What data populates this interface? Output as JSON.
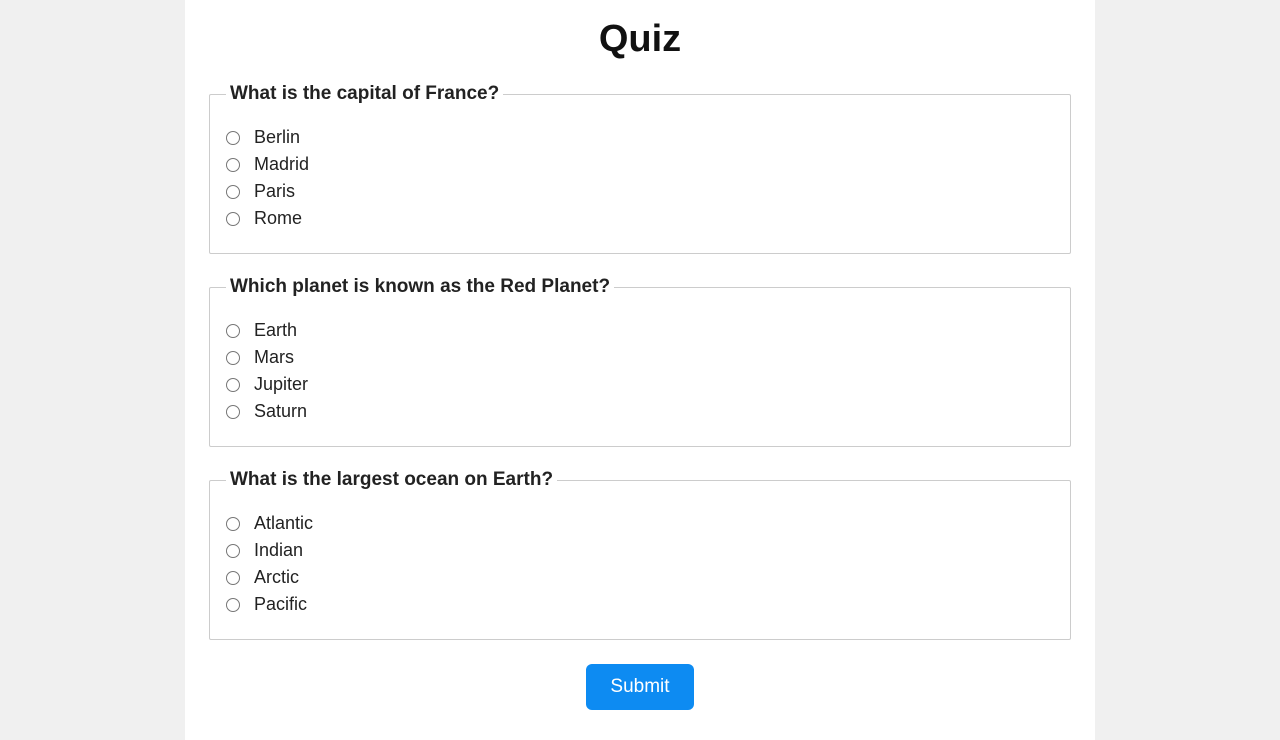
{
  "title": "Quiz",
  "submit_label": "Submit",
  "questions": [
    {
      "text": "What is the capital of France?",
      "options": [
        "Berlin",
        "Madrid",
        "Paris",
        "Rome"
      ]
    },
    {
      "text": "Which planet is known as the Red Planet?",
      "options": [
        "Earth",
        "Mars",
        "Jupiter",
        "Saturn"
      ]
    },
    {
      "text": "What is the largest ocean on Earth?",
      "options": [
        "Atlantic",
        "Indian",
        "Arctic",
        "Pacific"
      ]
    }
  ]
}
